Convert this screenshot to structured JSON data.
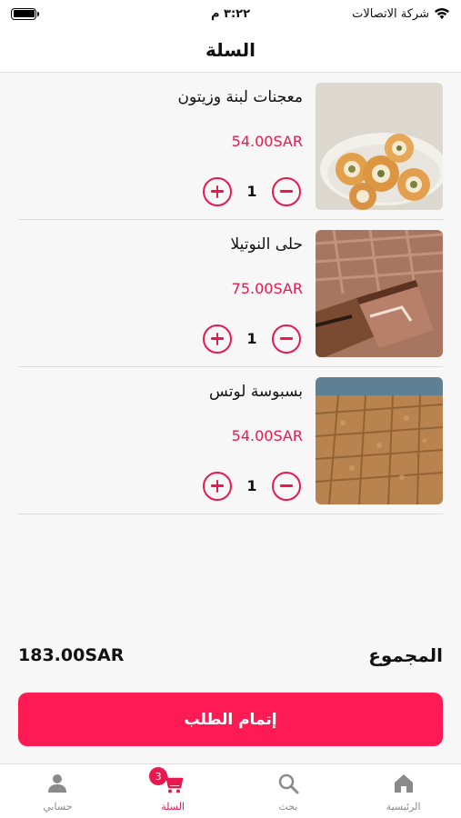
{
  "status_bar": {
    "carrier": "شركة الاتصالات",
    "time": "٣:٢٢ م"
  },
  "header": {
    "title": "السلة"
  },
  "cart": {
    "items": [
      {
        "name": "معجنات لبنة وزيتون",
        "price": "54.00SAR",
        "quantity": "1",
        "image": "pastries-image"
      },
      {
        "name": "حلى النوتيلا",
        "price": "75.00SAR",
        "quantity": "1",
        "image": "nutella-dessert-image"
      },
      {
        "name": "بسبوسة لوتس",
        "price": "54.00SAR",
        "quantity": "1",
        "image": "basbousa-image"
      }
    ]
  },
  "summary": {
    "total_label": "المجموع",
    "total_value": "183.00SAR"
  },
  "checkout": {
    "label": "إتمام الطلب"
  },
  "tab_bar": {
    "tabs": [
      {
        "label": "الرئيسية",
        "icon": "home-icon"
      },
      {
        "label": "بحث",
        "icon": "search-icon"
      },
      {
        "label": "السلة",
        "icon": "cart-icon",
        "badge": "3",
        "active": true
      },
      {
        "label": "حسابي",
        "icon": "person-icon"
      }
    ]
  },
  "colors": {
    "accent": "#e8194f",
    "button": "#fe1a52",
    "background": "#f7f7f7",
    "inactive": "#8a8a8a"
  }
}
